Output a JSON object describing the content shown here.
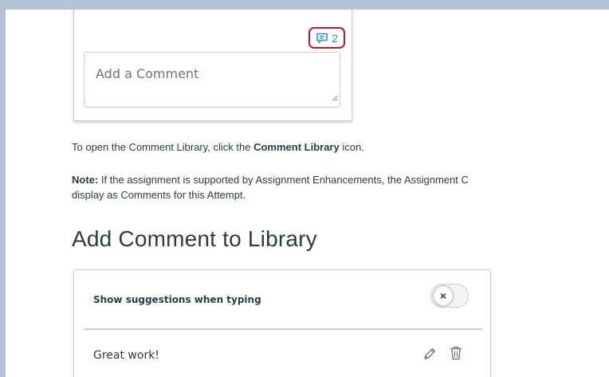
{
  "comment_panel": {
    "comment_count": "2",
    "comment_placeholder": "Add a Comment"
  },
  "instructions": {
    "open_prefix": "To open the Comment Library, click the ",
    "open_bold": "Comment Library",
    "open_suffix": " icon.",
    "note_label": "Note:",
    "note_line1": " If the assignment is supported by Assignment Enhancements, the Assignment C",
    "note_line2": "display as Comments for this Attempt."
  },
  "section_heading": "Add Comment to Library",
  "library": {
    "suggestions_label": "Show suggestions when typing",
    "toggle_symbol": "×",
    "items": [
      {
        "text": "Great work!"
      }
    ]
  },
  "colors": {
    "accent_blue": "#2d8fd5",
    "highlight_red": "#b11f24",
    "background": "#b3c2d4"
  },
  "icons": {
    "comment_count": "speech-bubble-icon",
    "edit": "pencil-icon",
    "delete": "trash-icon"
  }
}
